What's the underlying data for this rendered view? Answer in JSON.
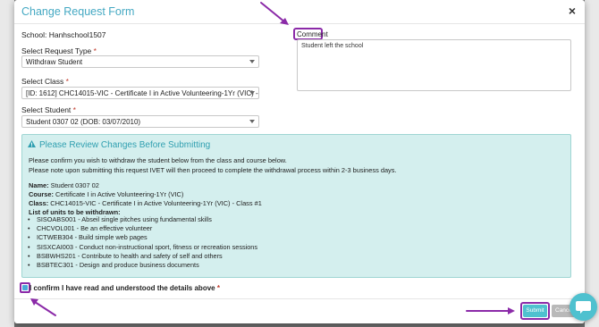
{
  "modal": {
    "title": "Change Request Form",
    "close_glyph": "×"
  },
  "form": {
    "school_label": "School: Hanhschool1507",
    "request_type": {
      "label": "Select Request Type",
      "required_mark": "*",
      "value": "Withdraw Student"
    },
    "class": {
      "label": "Select Class",
      "required_mark": "*",
      "value": "[ID: 1612] CHC14015-VIC - Certificate I in Active Volunteering-1Yr (VIC) - Class..."
    },
    "student": {
      "label": "Select Student",
      "required_mark": "*",
      "value": "Student 0307 02 (DOB: 03/07/2010)"
    },
    "comment": {
      "label": "Comment",
      "value": "Student left the school"
    }
  },
  "alert": {
    "title": "Please Review Changes Before Submitting",
    "icon": "warning-icon",
    "line1": "Please confirm you wish to withdraw the student below from the class and course below.",
    "line2": "Please note upon submitting this request IVET will then proceed to complete the withdrawal process within 2-3 business days.",
    "name_label": "Name:",
    "name_value": "Student 0307 02",
    "course_label": "Course:",
    "course_value": "Certificate I in Active Volunteering-1Yr (VIC)",
    "class_label": "Class:",
    "class_value": "CHC14015-VIC - Certificate I in Active Volunteering-1Yr (VIC) - Class #1",
    "units_label": "List of units to be withdrawn:",
    "units": [
      "SISOABS001 - Abseil single pitches using fundamental skills",
      "CHCVOL001 - Be an effective volunteer",
      "ICTWEB304 - Build simple web pages",
      "SISXCAI003 - Conduct non-instructional sport, fitness or recreation sessions",
      "BSBWHS201 - Contribute to health and safety of self and others",
      "BSBTEC301 - Design and produce business documents"
    ]
  },
  "confirm": {
    "label": "I confirm I have read and understood the details above",
    "required_mark": "*",
    "checked": true
  },
  "buttons": {
    "submit": "Submit",
    "cancel": "Cance"
  },
  "colors": {
    "accent": "#45a9c3",
    "alert_bg": "#d4efee",
    "highlight": "#8b2aa8",
    "submit": "#4fc1cf"
  }
}
